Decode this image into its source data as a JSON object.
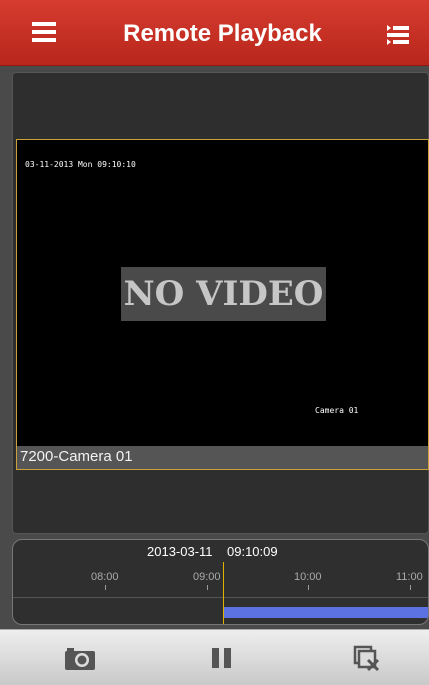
{
  "header": {
    "title": "Remote Playback",
    "menu_icon": "hamburger-menu-icon",
    "list_icon": "playlist-icon",
    "color": "#c8321f"
  },
  "video": {
    "osd_timestamp": "03-11-2013 Mon 09:10:10",
    "status_text": "NO VIDEO",
    "osd_camera": "Camera 01",
    "channel_label": "7200-Camera 01",
    "selected_border_color": "#c9a23a"
  },
  "timeline": {
    "date": "2013-03-11",
    "time": "09:10:09",
    "ticks": [
      "08:00",
      "09:00",
      "10:00",
      "11:00"
    ],
    "cursor_color": "#e0b000",
    "recording_color": "#5b72e0"
  },
  "toolbar": {
    "buttons": [
      {
        "icon": "camera-icon",
        "action": "snapshot"
      },
      {
        "icon": "pause-icon",
        "action": "pause"
      },
      {
        "icon": "close-window-icon",
        "action": "stop"
      }
    ]
  }
}
